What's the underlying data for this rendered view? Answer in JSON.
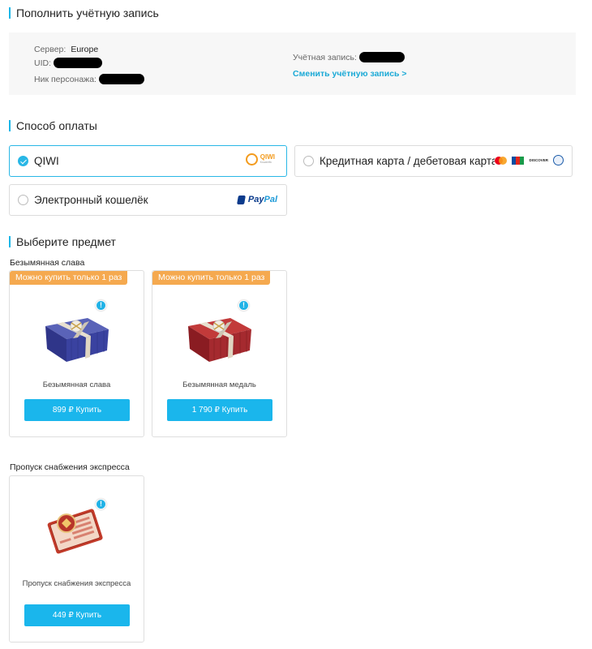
{
  "account_section": {
    "title": "Пополнить учётную запись",
    "server_label": "Сервер:",
    "server_value": "Europe",
    "uid_label": "UID:",
    "nickname_label": "Ник персонажа:",
    "account_label": "Учётная запись:",
    "switch_link": "Сменить учётную запись >"
  },
  "payment_section": {
    "title": "Способ оплаты",
    "options": [
      {
        "label": "QIWI",
        "selected": true,
        "logo": "qiwi-logo"
      },
      {
        "label": "Кредитная карта / дебетовая карта",
        "selected": false,
        "logo": "card-logos"
      },
      {
        "label": "Электронный кошелёк",
        "selected": false,
        "logo": "paypal-logo"
      }
    ],
    "qiwi_logo_text": "QIWI",
    "qiwi_logo_sub": "Кошелёк",
    "paypal_text_1": "Pay",
    "paypal_text_2": "Pal",
    "discover_text": "DISCOVER"
  },
  "items_section": {
    "title": "Выберите предмет",
    "groups": [
      {
        "label": "Безымянная слава",
        "items": [
          {
            "badge": "Можно купить только 1 раз",
            "name": "Безымянная слава",
            "buy_label": "899 ₽ Купить",
            "art": "blue-gift-box-icon"
          },
          {
            "badge": "Можно купить только 1 раз",
            "name": "Безымянная медаль",
            "buy_label": "1 790 ₽ Купить",
            "art": "red-gift-box-icon"
          }
        ]
      },
      {
        "label": "Пропуск снабжения экспресса",
        "items": [
          {
            "name": "Пропуск снабжения экспресса",
            "buy_label": "449 ₽ Купить",
            "art": "supply-pass-ticket-icon"
          }
        ]
      }
    ],
    "info_icon_glyph": "!"
  },
  "colors": {
    "accent": "#1ab6ec",
    "badge": "#f5a94f",
    "qiwi": "#f39b1d",
    "paypal_dark": "#0b3b8c",
    "paypal_light": "#1f9bd8"
  }
}
